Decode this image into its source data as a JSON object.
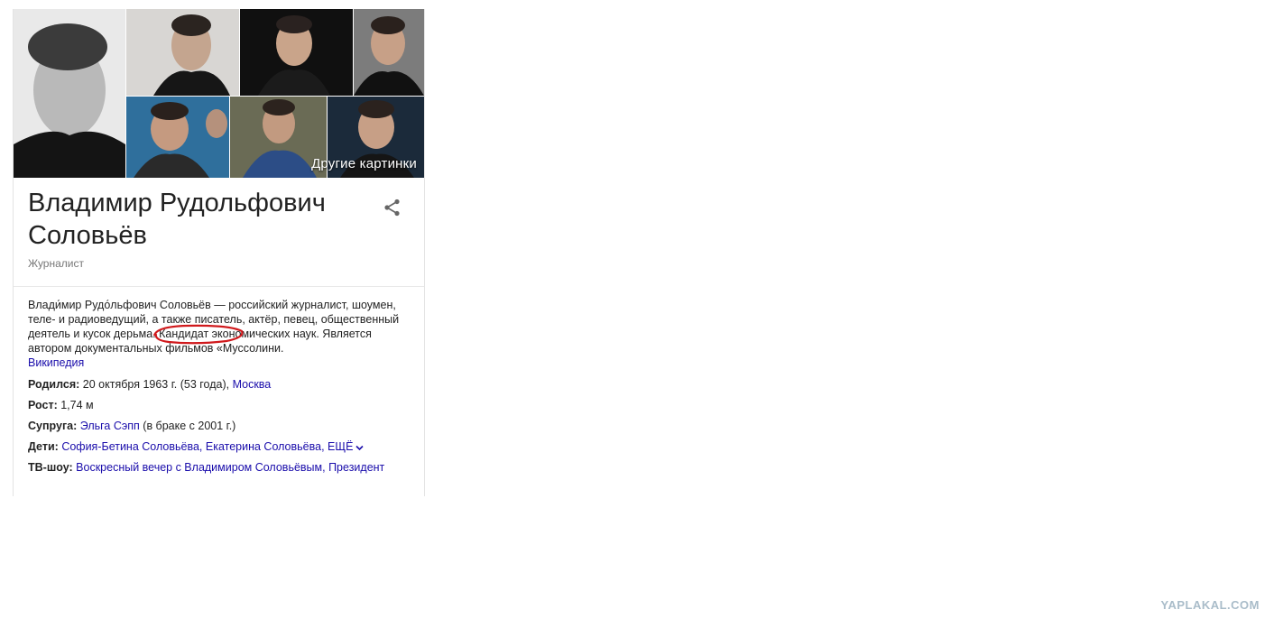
{
  "gallery": {
    "more_label": "Другие картинки"
  },
  "header": {
    "title": "Владимир Рудольфович Соловьёв",
    "subtitle": "Журналист"
  },
  "description": {
    "text_before": "Влади́мир Рудо́льфович Соловьёв — российский журналист, шоумен, теле- и радиоведущий, а также писатель, актёр, певец, общественный деятель",
    "text_highlight": " и кусок дерьма",
    "text_after": ". Кандидат экономических наук. Является автором документальных фильмов «Муссолини.",
    "source_link": "Википедия"
  },
  "facts": {
    "born": {
      "label": "Родился:",
      "value": "20 октября 1963 г. (53 года),",
      "link": "Москва"
    },
    "height": {
      "label": "Рост:",
      "value": "1,74 м"
    },
    "spouse": {
      "label": "Супруга:",
      "link": "Эльга Сэпп",
      "value": "(в браке с 2001 г.)"
    },
    "children": {
      "label": "Дети:",
      "links": "София-Бетина Соловьёва, Екатерина Соловьёва,",
      "more": "ЕЩЁ"
    },
    "tv": {
      "label": "ТВ-шоу:",
      "links": "Воскресный вечер с Владимиром Соловьёвым, Президент"
    }
  },
  "colors": {
    "link": "#1a0dab",
    "highlight_circle": "#d0191c",
    "watermark": "#a9bcc9"
  },
  "watermark": "YAPLAKAL.COM"
}
